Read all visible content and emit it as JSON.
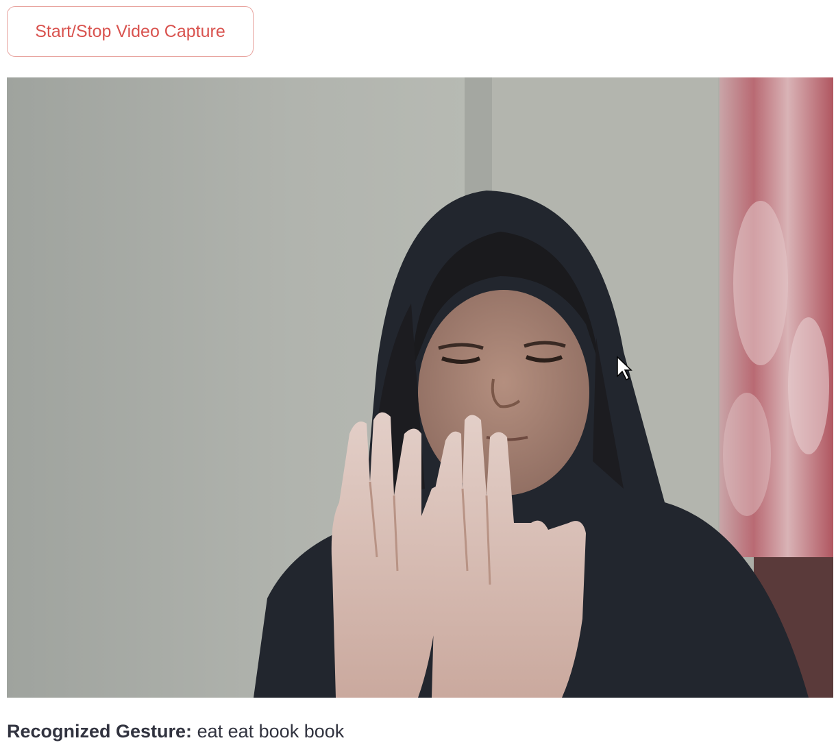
{
  "toolbar": {
    "capture_button_label": "Start/Stop Video Capture"
  },
  "video": {
    "feed_description_icon": "webcam-feed-icon"
  },
  "result": {
    "label": "Recognized Gesture:",
    "value": "eat eat book book"
  },
  "colors": {
    "accent": "#d9534f",
    "button_border": "#e8a49f",
    "text": "#31333f"
  }
}
